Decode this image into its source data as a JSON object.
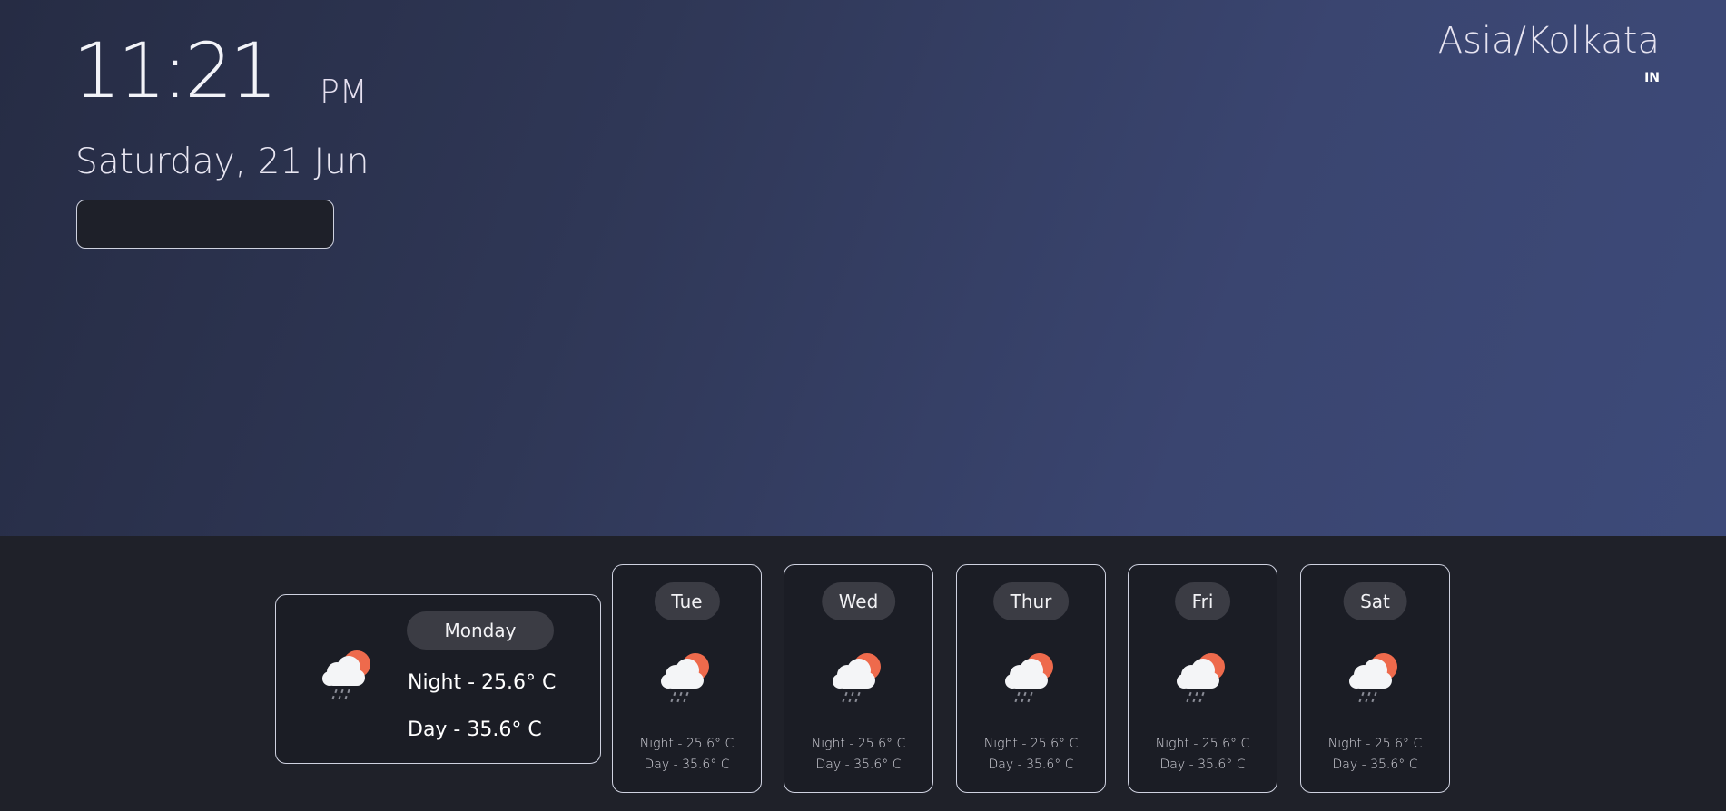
{
  "clock": {
    "time": "11:21",
    "ampm": "PM",
    "date": "Saturday, 21 Jun"
  },
  "location": {
    "timezone": "Asia/Kolkata",
    "country": "IN"
  },
  "search": {
    "value": ""
  },
  "today": {
    "day": "Monday",
    "night": "Night - 25.6° C",
    "day_temp": "Day - 35.6° C",
    "icon": "cloud-sun-rain-icon"
  },
  "forecast": [
    {
      "day": "Tue",
      "night": "Night - 25.6° C",
      "day_temp": "Day - 35.6° C",
      "icon": "cloud-sun-rain-icon"
    },
    {
      "day": "Wed",
      "night": "Night - 25.6° C",
      "day_temp": "Day - 35.6° C",
      "icon": "cloud-sun-rain-icon"
    },
    {
      "day": "Thur",
      "night": "Night - 25.6° C",
      "day_temp": "Day - 35.6° C",
      "icon": "cloud-sun-rain-icon"
    },
    {
      "day": "Fri",
      "night": "Night - 25.6° C",
      "day_temp": "Day - 35.6° C",
      "icon": "cloud-sun-rain-icon"
    },
    {
      "day": "Sat",
      "night": "Night - 25.6° C",
      "day_temp": "Day - 35.6° C",
      "icon": "cloud-sun-rain-icon"
    }
  ],
  "colors": {
    "sun": "#ee6a4c",
    "cloud": "#f4f5f7",
    "rain": "#8a8c96",
    "top_bg_start": "#262c44",
    "top_bg_end": "#3d4a79",
    "bottom_bg": "#1f2129"
  }
}
